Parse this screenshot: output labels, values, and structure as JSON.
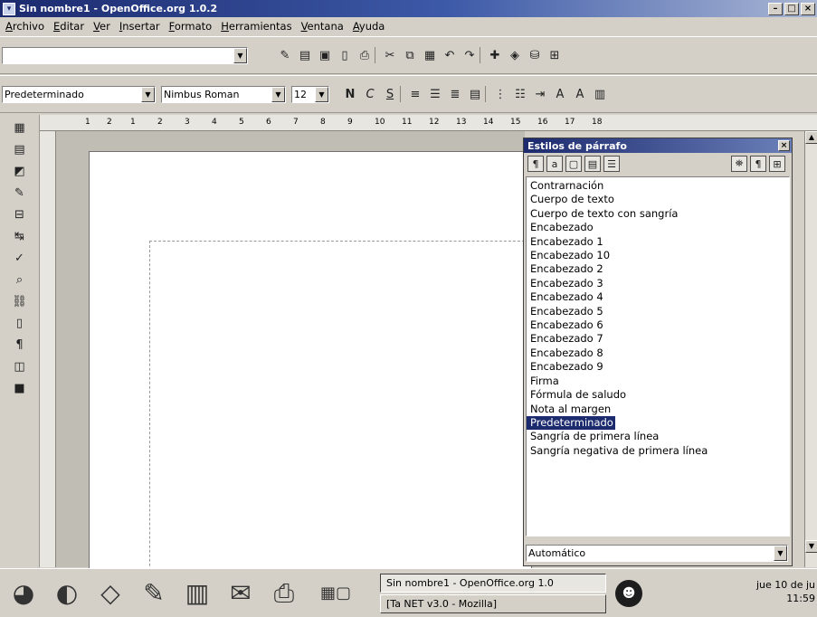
{
  "window": {
    "title": "Sin nombre1 - OpenOffice.org 1.0.2"
  },
  "menu": [
    "Archivo",
    "Editar",
    "Ver",
    "Insertar",
    "Formato",
    "Herramientas",
    "Ventana",
    "Ayuda"
  ],
  "format_bar": {
    "paragraph_style": "Predeterminado",
    "font_name": "Nimbus Roman",
    "font_size": "12"
  },
  "ruler_ticks": [
    "1",
    "2",
    "1",
    "2",
    "3",
    "4",
    "5",
    "6",
    "7",
    "8",
    "9",
    "10",
    "11",
    "12",
    "13",
    "14",
    "15",
    "16",
    "17",
    "18"
  ],
  "stylist": {
    "title": "Estilos de párrafo",
    "styles": [
      "Contrarnación",
      "Cuerpo de texto",
      "Cuerpo de texto con sangría",
      "Encabezado",
      "Encabezado 1",
      "Encabezado 10",
      "Encabezado 2",
      "Encabezado 3",
      "Encabezado 4",
      "Encabezado 5",
      "Encabezado 6",
      "Encabezado 7",
      "Encabezado 8",
      "Encabezado 9",
      "Firma",
      "Fórmula de saludo",
      "Nota al margen",
      "Predeterminado",
      "Sangría de primera línea",
      "Sangría negativa de primera línea"
    ],
    "selected_index": 17,
    "filter": "Automático"
  },
  "taskbar": {
    "tasks": [
      {
        "label": "Sin nombre1 - OpenOffice.org 1.0",
        "active": true
      },
      {
        "label": "[Ta NET v3.0 - Mozilla]",
        "active": false
      }
    ],
    "clock_date": "jue 10 de ju",
    "clock_time": "11:59"
  }
}
